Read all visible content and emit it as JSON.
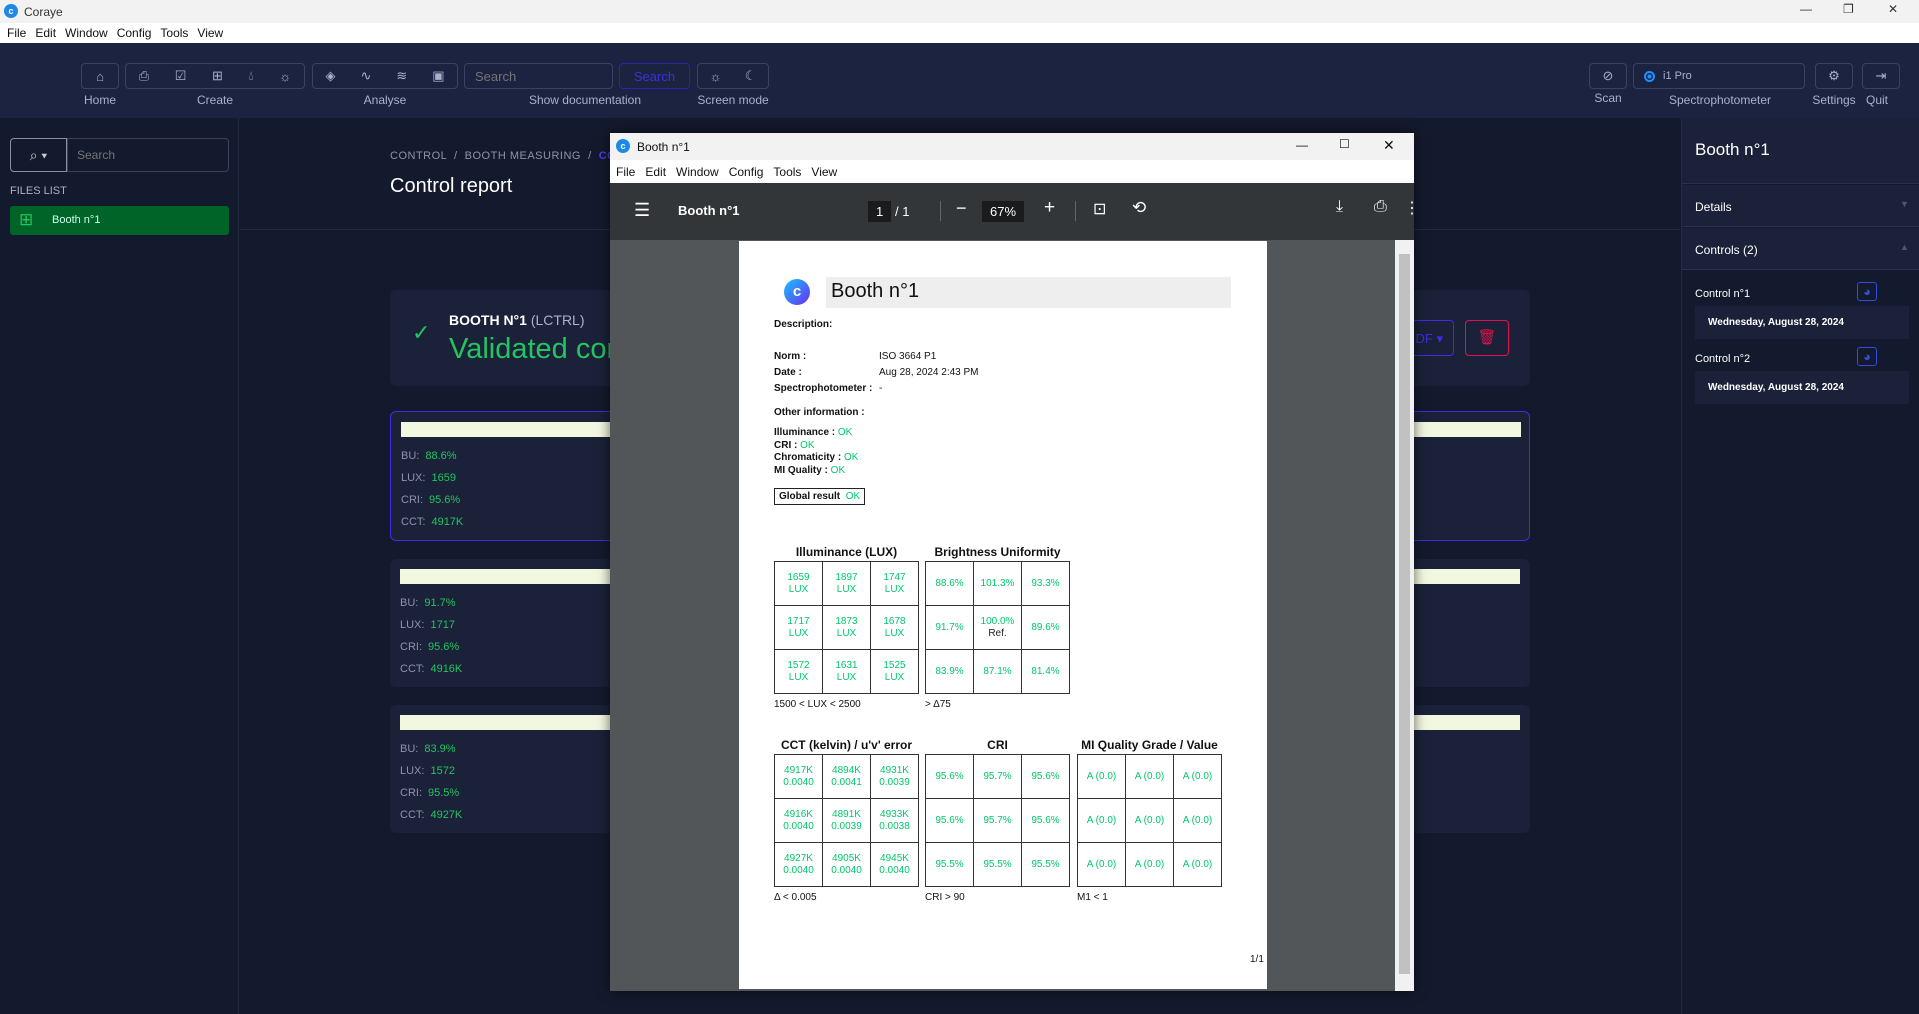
{
  "app": {
    "title": "Coraye",
    "menu": [
      "File",
      "Edit",
      "Window",
      "Config",
      "Tools",
      "View"
    ]
  },
  "toolbar": {
    "home": "Home",
    "create": "Create",
    "analyse": "Analyse",
    "search_placeholder": "Search",
    "search_button": "Search",
    "show_doc": "Show documentation",
    "screen_mode": "Screen mode",
    "scan": "Scan",
    "spectro_value": "i1 Pro",
    "spectro_label": "Spectrophotometer",
    "settings": "Settings",
    "quit": "Quit"
  },
  "sidebar": {
    "search_placeholder": "Search",
    "files_label": "FILES LIST",
    "files": [
      {
        "label": "Booth n°1"
      }
    ]
  },
  "main": {
    "breadcrumb": [
      "CONTROL",
      "BOOTH MEASURING",
      "CON"
    ],
    "title": "Control report",
    "booth_name": "BOOTH N°1",
    "booth_code": "(LCTRL)",
    "status": "Validated cont",
    "pdf_button": "DF",
    "cards": [
      {
        "BU": "88.6%",
        "LUX": "1659",
        "CRI": "95.6%",
        "CCT": "4917K"
      },
      {
        "BU": "91.7%",
        "LUX": "1717",
        "CRI": "95.6%",
        "CCT": "4916K"
      },
      {
        "BU": "83.9%",
        "LUX": "1572",
        "CRI": "95.5%",
        "CCT": "4927K"
      }
    ]
  },
  "right_panel": {
    "title": "Booth n°1",
    "details": "Details",
    "controls": "Controls (2)",
    "items": [
      {
        "name": "Control n°1",
        "date": "Wednesday, August 28, 2024"
      },
      {
        "name": "Control n°2",
        "date": "Wednesday, August 28, 2024"
      }
    ]
  },
  "pdf": {
    "window_title": "Booth n°1",
    "menu": [
      "File",
      "Edit",
      "Window",
      "Config",
      "Tools",
      "View"
    ],
    "doc_title": "Booth n°1",
    "page_current": "1",
    "page_total": "/ 1",
    "zoom": "67%",
    "page": {
      "title": "Booth n°1",
      "description_label": "Description:",
      "norm_label": "Norm :",
      "norm": "ISO 3664 P1",
      "date_label": "Date :",
      "date": "Aug 28, 2024 2:43 PM",
      "spectro_label": "Spectrophotometer :",
      "spectro": "-",
      "other_label": "Other information :",
      "checks": [
        {
          "label": "Illuminance : ",
          "value": "OK"
        },
        {
          "label": "CRI : ",
          "value": "OK"
        },
        {
          "label": "Chromaticity : ",
          "value": "OK"
        },
        {
          "label": "MI Quality : ",
          "value": "OK"
        }
      ],
      "global_label": "Global result",
      "global_value": "OK",
      "page_number": "1/1",
      "tables": [
        {
          "title": "Illuminance (LUX)",
          "caption": "1500 < LUX < 2500",
          "cells": [
            [
              "1659\nLUX",
              "1897\nLUX",
              "1747\nLUX"
            ],
            [
              "1717\nLUX",
              "1873\nLUX",
              "1678\nLUX"
            ],
            [
              "1572\nLUX",
              "1631\nLUX",
              "1525\nLUX"
            ]
          ]
        },
        {
          "title": "Brightness Uniformity",
          "caption": "> Δ75",
          "cells": [
            [
              "88.6%",
              "101.3%",
              "93.3%"
            ],
            [
              "91.7%",
              "100.0%\nRef.",
              "89.6%"
            ],
            [
              "83.9%",
              "87.1%",
              "81.4%"
            ]
          ]
        },
        {
          "title": "CCT (kelvin) / u'v' error",
          "caption": "Δ < 0.005",
          "cells": [
            [
              "4917K\n0.0040",
              "4894K\n0.0041",
              "4931K\n0.0039"
            ],
            [
              "4916K\n0.0040",
              "4891K\n0.0039",
              "4933K\n0.0038"
            ],
            [
              "4927K\n0.0040",
              "4905K\n0.0040",
              "4945K\n0.0040"
            ]
          ]
        },
        {
          "title": "CRI",
          "caption": "CRI > 90",
          "cells": [
            [
              "95.6%",
              "95.7%",
              "95.6%"
            ],
            [
              "95.6%",
              "95.7%",
              "95.6%"
            ],
            [
              "95.5%",
              "95.5%",
              "95.5%"
            ]
          ]
        },
        {
          "title": "MI Quality Grade / Value",
          "caption": "M1 < 1",
          "cells": [
            [
              "A (0.0)",
              "A (0.0)",
              "A (0.0)"
            ],
            [
              "A (0.0)",
              "A (0.0)",
              "A (0.0)"
            ],
            [
              "A (0.0)",
              "A (0.0)",
              "A (0.0)"
            ]
          ]
        }
      ]
    }
  },
  "colors": {
    "accent": "#3b2fe0",
    "ok": "#22c55e",
    "danger": "#e0134a",
    "file_active": "#006428"
  }
}
